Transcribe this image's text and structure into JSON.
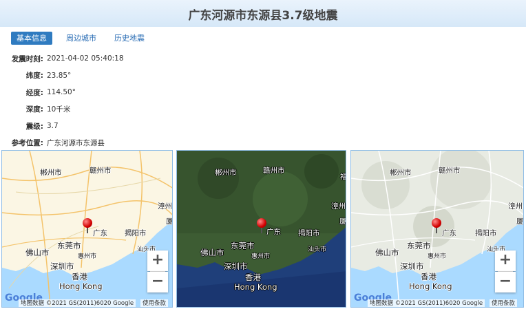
{
  "header": {
    "title": "广东河源市东源县3.7级地震"
  },
  "tabs": [
    {
      "label": "基本信息",
      "active": true
    },
    {
      "label": "周边城市",
      "active": false
    },
    {
      "label": "历史地震",
      "active": false
    }
  ],
  "info": [
    {
      "label": "发震时刻:",
      "value": "2021-04-02 05:40:18"
    },
    {
      "label": "纬度:",
      "value": "23.85°"
    },
    {
      "label": "经度:",
      "value": "114.50°"
    },
    {
      "label": "深度:",
      "value": "10千米"
    },
    {
      "label": "震级:",
      "value": "3.7"
    },
    {
      "label": "参考位置:",
      "value": "广东河源市东源县"
    }
  ],
  "maps": [
    {
      "type": "road",
      "cities": {
        "chenzhou": "郴州市",
        "ganzhou": "赣州市",
        "zhangzhou": "漳州市",
        "guangdong": "广东",
        "jieyang": "揭阳市",
        "foshan": "佛山市",
        "dongguan": "东莞市",
        "huizhou": "惠州市",
        "shantou": "汕头市",
        "shenzhen": "深圳市",
        "xianggang": "香港",
        "hongkong": "Hong Kong",
        "xia": "厦"
      },
      "zoom_in": "+",
      "zoom_out": "−",
      "google": "Google",
      "attribution": "地图数据 ©2021 GS(2011)6020 Google",
      "terms": "使用条款"
    },
    {
      "type": "satellite",
      "cities": {
        "chenzhou": "郴州市",
        "ganzhou": "赣州市",
        "zhangzhou": "漳州市",
        "guangdong": "广东",
        "jieyang": "揭阳市",
        "foshan": "佛山市",
        "dongguan": "东莞市",
        "huizhou": "惠州市",
        "shantou": "汕头市",
        "shenzhen": "深圳市",
        "xianggang": "香港",
        "hongkong": "Hong Kong",
        "fu": "福",
        "xia": "厦"
      }
    },
    {
      "type": "terrain",
      "cities": {
        "chenzhou": "郴州市",
        "ganzhou": "赣州市",
        "zhangzhou": "漳州市",
        "guangdong": "广东",
        "jieyang": "揭阳市",
        "foshan": "佛山市",
        "dongguan": "东莞市",
        "huizhou": "惠州市",
        "shantou": "汕头市",
        "shenzhen": "深圳市",
        "xianggang": "香港",
        "hongkong": "Hong Kong",
        "xia": "厦"
      },
      "zoom_in": "+",
      "zoom_out": "−",
      "google": "Google",
      "attribution": "地图数据 ©2021 GS(2011)6020 Google",
      "terms": "使用条款"
    }
  ],
  "colors": {
    "accent": "#2f7bc0",
    "pin": "#d30000",
    "sea_road": "#aadaff",
    "land_road": "#fbf6e4",
    "sea_sat": "#1f3f7a",
    "land_sat": "#3d5c33"
  },
  "icons": {
    "marker": "map-marker-icon",
    "zoom_in": "plus-icon",
    "zoom_out": "minus-icon"
  }
}
